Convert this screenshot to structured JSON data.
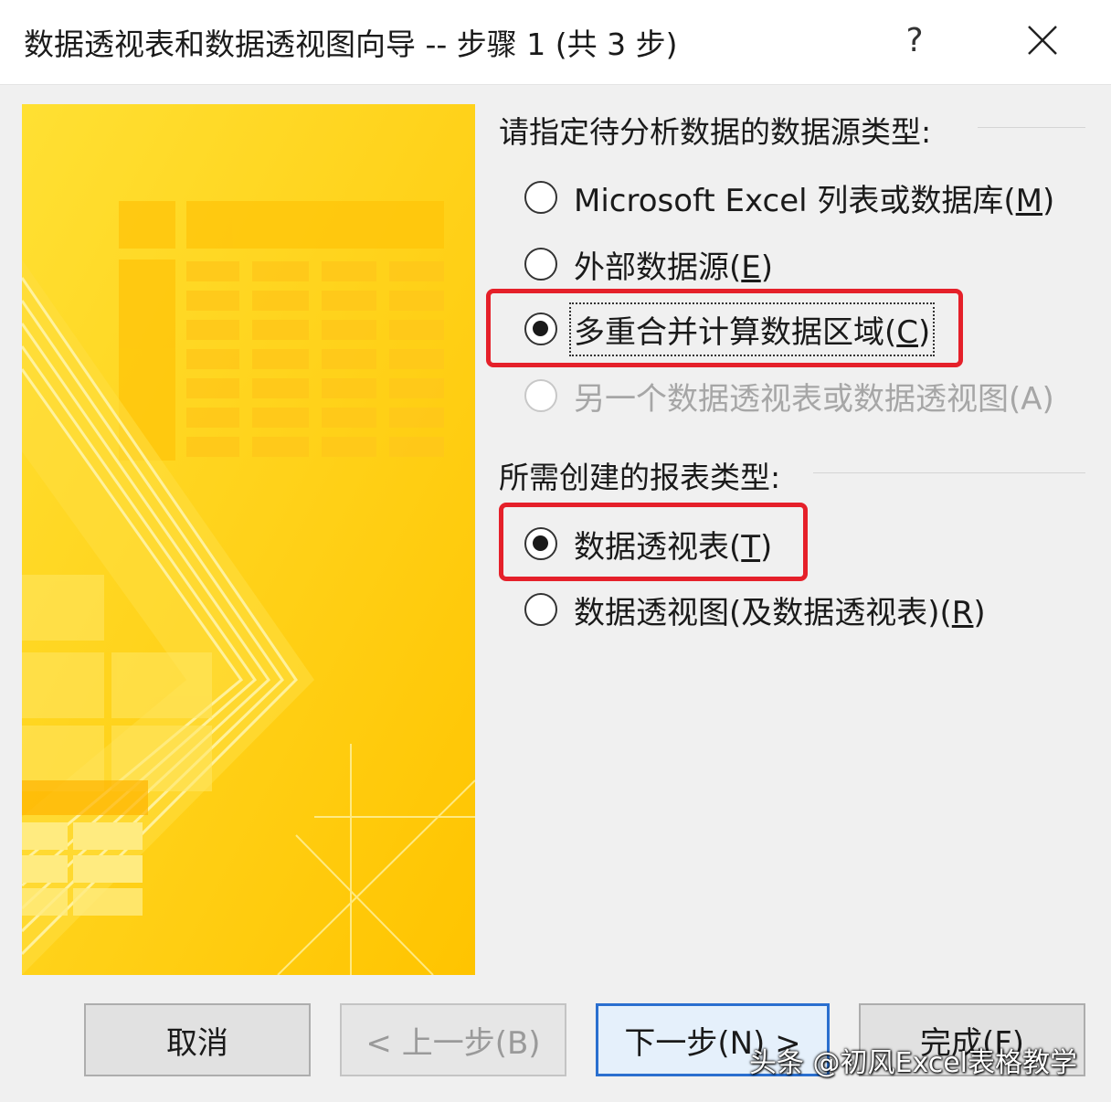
{
  "window": {
    "title": "数据透视表和数据透视图向导 -- 步骤 1 (共 3 步)",
    "help_label": "?",
    "close_icon": "close-icon"
  },
  "data_source": {
    "label": "请指定待分析数据的数据源类型:",
    "options": [
      {
        "text": "Microsoft Excel 列表或数据库(",
        "key": "M",
        "suffix": ")",
        "checked": false,
        "disabled": false
      },
      {
        "text": "外部数据源(",
        "key": "E",
        "suffix": ")",
        "checked": false,
        "disabled": false
      },
      {
        "text": "多重合并计算数据区域(",
        "key": "C",
        "suffix": ")",
        "checked": true,
        "disabled": false
      },
      {
        "text": "另一个数据透视表或数据透视图(A)",
        "key": "",
        "suffix": "",
        "checked": false,
        "disabled": true
      }
    ]
  },
  "report_type": {
    "label": "所需创建的报表类型:",
    "options": [
      {
        "text": "数据透视表(",
        "key": "T",
        "suffix": ")",
        "checked": true
      },
      {
        "text": "数据透视图(及数据透视表)(",
        "key": "R",
        "suffix": ")",
        "checked": false
      }
    ]
  },
  "buttons": {
    "cancel": "取消",
    "back": "< 上一步(B)",
    "next": "下一步(N) >",
    "finish": "完成(F)"
  },
  "watermark": "头条 @初风Excel表格教学",
  "colors": {
    "highlight": "#e5202a",
    "art_yellow": "#ffd21a",
    "primary_border": "#2a6fcf"
  }
}
